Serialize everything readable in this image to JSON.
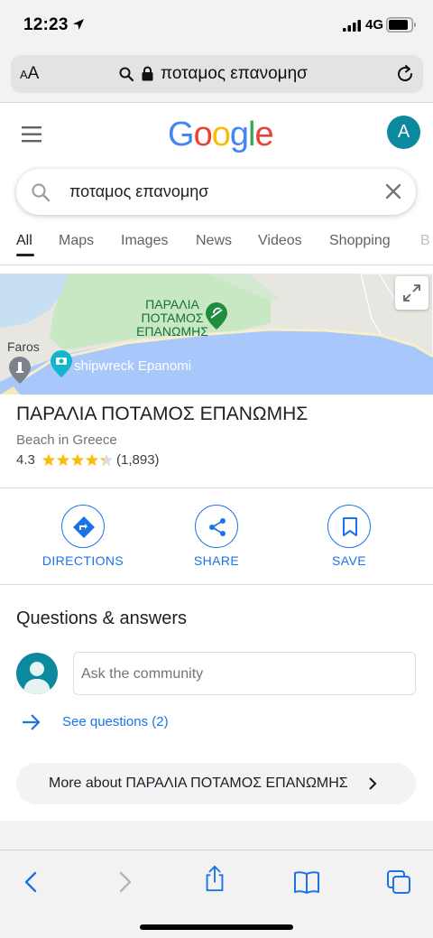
{
  "status_bar": {
    "time": "12:23",
    "network": "4G"
  },
  "address_bar": {
    "aa_small": "A",
    "aa_large": "A",
    "url_text": "ποταμος επανομησ"
  },
  "header": {
    "logo": [
      "G",
      "o",
      "o",
      "g",
      "l",
      "e"
    ],
    "logo_colors": [
      "#4285F4",
      "#EA4335",
      "#FBBC05",
      "#4285F4",
      "#34A853",
      "#EA4335"
    ],
    "avatar_letter": "A"
  },
  "search": {
    "query": "ποταμος επανομησ"
  },
  "tabs": [
    {
      "label": "All",
      "active": true
    },
    {
      "label": "Maps"
    },
    {
      "label": "Images"
    },
    {
      "label": "News"
    },
    {
      "label": "Videos"
    },
    {
      "label": "Shopping"
    },
    {
      "label": "B"
    }
  ],
  "map": {
    "place_label_lines": [
      "ΠΑΡΑΛΙΑ",
      "ΠΟΤΑΜΟΣ",
      "ΕΠΑΝΩΜΗΣ"
    ],
    "faros_label": "Faros",
    "shipwreck_label": "shipwreck Epanomi"
  },
  "place": {
    "title": "ΠΑΡΑΛΙΑ ΠΟΤΑΜΟΣ ΕΠΑΝΩΜΗΣ",
    "type": "Beach in Greece",
    "rating": 4.3,
    "rating_text": "4.3",
    "review_count": "(1,893)"
  },
  "actions": [
    {
      "label": "DIRECTIONS",
      "icon": "directions-icon"
    },
    {
      "label": "SHARE",
      "icon": "share-icon"
    },
    {
      "label": "SAVE",
      "icon": "bookmark-icon"
    }
  ],
  "qa": {
    "title": "Questions & answers",
    "ask_placeholder": "Ask the community",
    "see_questions": "See questions (2)"
  },
  "more_about": "More about ΠΑΡΑΛΙΑ ΠΟΤΑΜΟΣ ΕΠΑΝΩΜΗΣ",
  "colors": {
    "accent": "#1a73e8",
    "avatar": "#0b8a9f",
    "star": "#fbbc04"
  }
}
